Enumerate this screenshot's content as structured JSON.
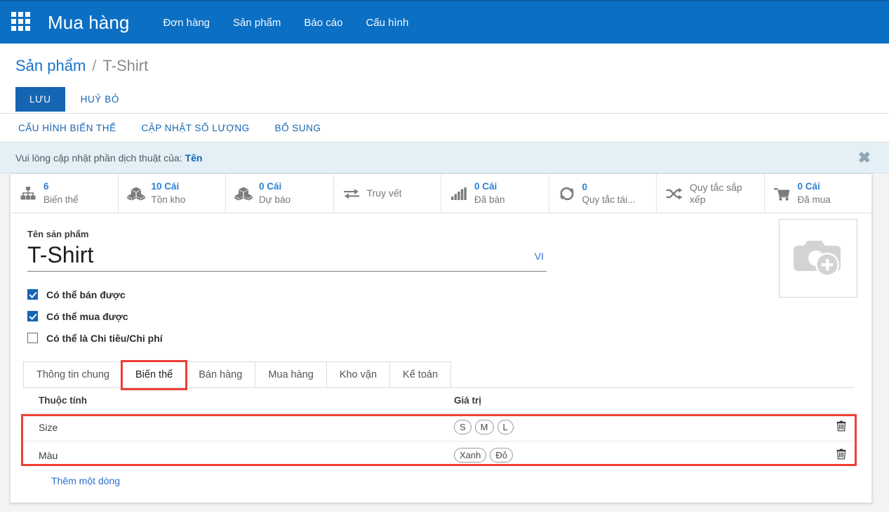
{
  "navbar": {
    "apps_icon": "grid-apps-icon",
    "brand": "Mua hàng",
    "menu": [
      {
        "label": "Đơn hàng"
      },
      {
        "label": "Sản phẩm"
      },
      {
        "label": "Báo cáo"
      },
      {
        "label": "Cấu hình"
      }
    ],
    "bg_color": "#0b6fc4"
  },
  "breadcrumb": {
    "root": "Sản phẩm",
    "separator": "/",
    "current": "T-Shirt"
  },
  "actions": {
    "save_label": "LƯU",
    "discard_label": "HUỶ BỎ"
  },
  "subbar": {
    "buttons": [
      {
        "label": "CẤU HÌNH BIẾN THỂ"
      },
      {
        "label": "CẬP NHẬT SỐ LƯỢNG"
      },
      {
        "label": "BỔ SUNG"
      }
    ]
  },
  "alert": {
    "text": "Vui lòng cập nhật phần dịch thuật của:",
    "field": "Tên",
    "close_icon": "close-x-icon",
    "bg_color": "#e4f0f6"
  },
  "stats": [
    {
      "icon": "hierarchy-icon",
      "value": "6",
      "label": "Biến thể"
    },
    {
      "icon": "boxes-icon",
      "value": "10 Cái",
      "label": "Tồn kho"
    },
    {
      "icon": "boxes-icon",
      "value": "0 Cái",
      "label": "Dự báo"
    },
    {
      "icon": "arrows-exchange-icon",
      "value": "",
      "label": "Truy vết"
    },
    {
      "icon": "bar-chart-icon",
      "value": "0 Cái",
      "label": "Đã bán"
    },
    {
      "icon": "refresh-cycle-icon",
      "value": "0",
      "label": "Quy tắc tái..."
    },
    {
      "icon": "shuffle-icon",
      "value": "",
      "label": "Quy tắc sắp xếp"
    },
    {
      "icon": "shopping-cart-icon",
      "value": "0 Cái",
      "label": "Đã mua"
    }
  ],
  "form": {
    "name_label": "Tên sản phẩm",
    "name_value": "T-Shirt",
    "lang_badge": "VI",
    "image_placeholder_icon": "camera-add-icon",
    "checkboxes": [
      {
        "label": "Có thể bán được",
        "checked": true
      },
      {
        "label": "Có thể mua được",
        "checked": true
      },
      {
        "label": "Có thể là Chi tiêu/Chi phí",
        "checked": false
      }
    ]
  },
  "tabs": [
    {
      "label": "Thông tin chung",
      "active": false
    },
    {
      "label": "Biến thể",
      "active": true
    },
    {
      "label": "Bán hàng",
      "active": false
    },
    {
      "label": "Mua hàng",
      "active": false
    },
    {
      "label": "Kho vận",
      "active": false
    },
    {
      "label": "Kế toán",
      "active": false
    }
  ],
  "attributes_table": {
    "headers": {
      "attribute": "Thuộc tính",
      "value": "Giá trị"
    },
    "rows": [
      {
        "attribute": "Size",
        "values": [
          "S",
          "M",
          "L"
        ],
        "delete_icon": "trash-icon"
      },
      {
        "attribute": "Màu",
        "values": [
          "Xanh",
          "Đỏ"
        ],
        "delete_icon": "trash-icon"
      }
    ],
    "add_line_label": "Thêm một dòng",
    "highlight_color": "#ee3f36"
  }
}
